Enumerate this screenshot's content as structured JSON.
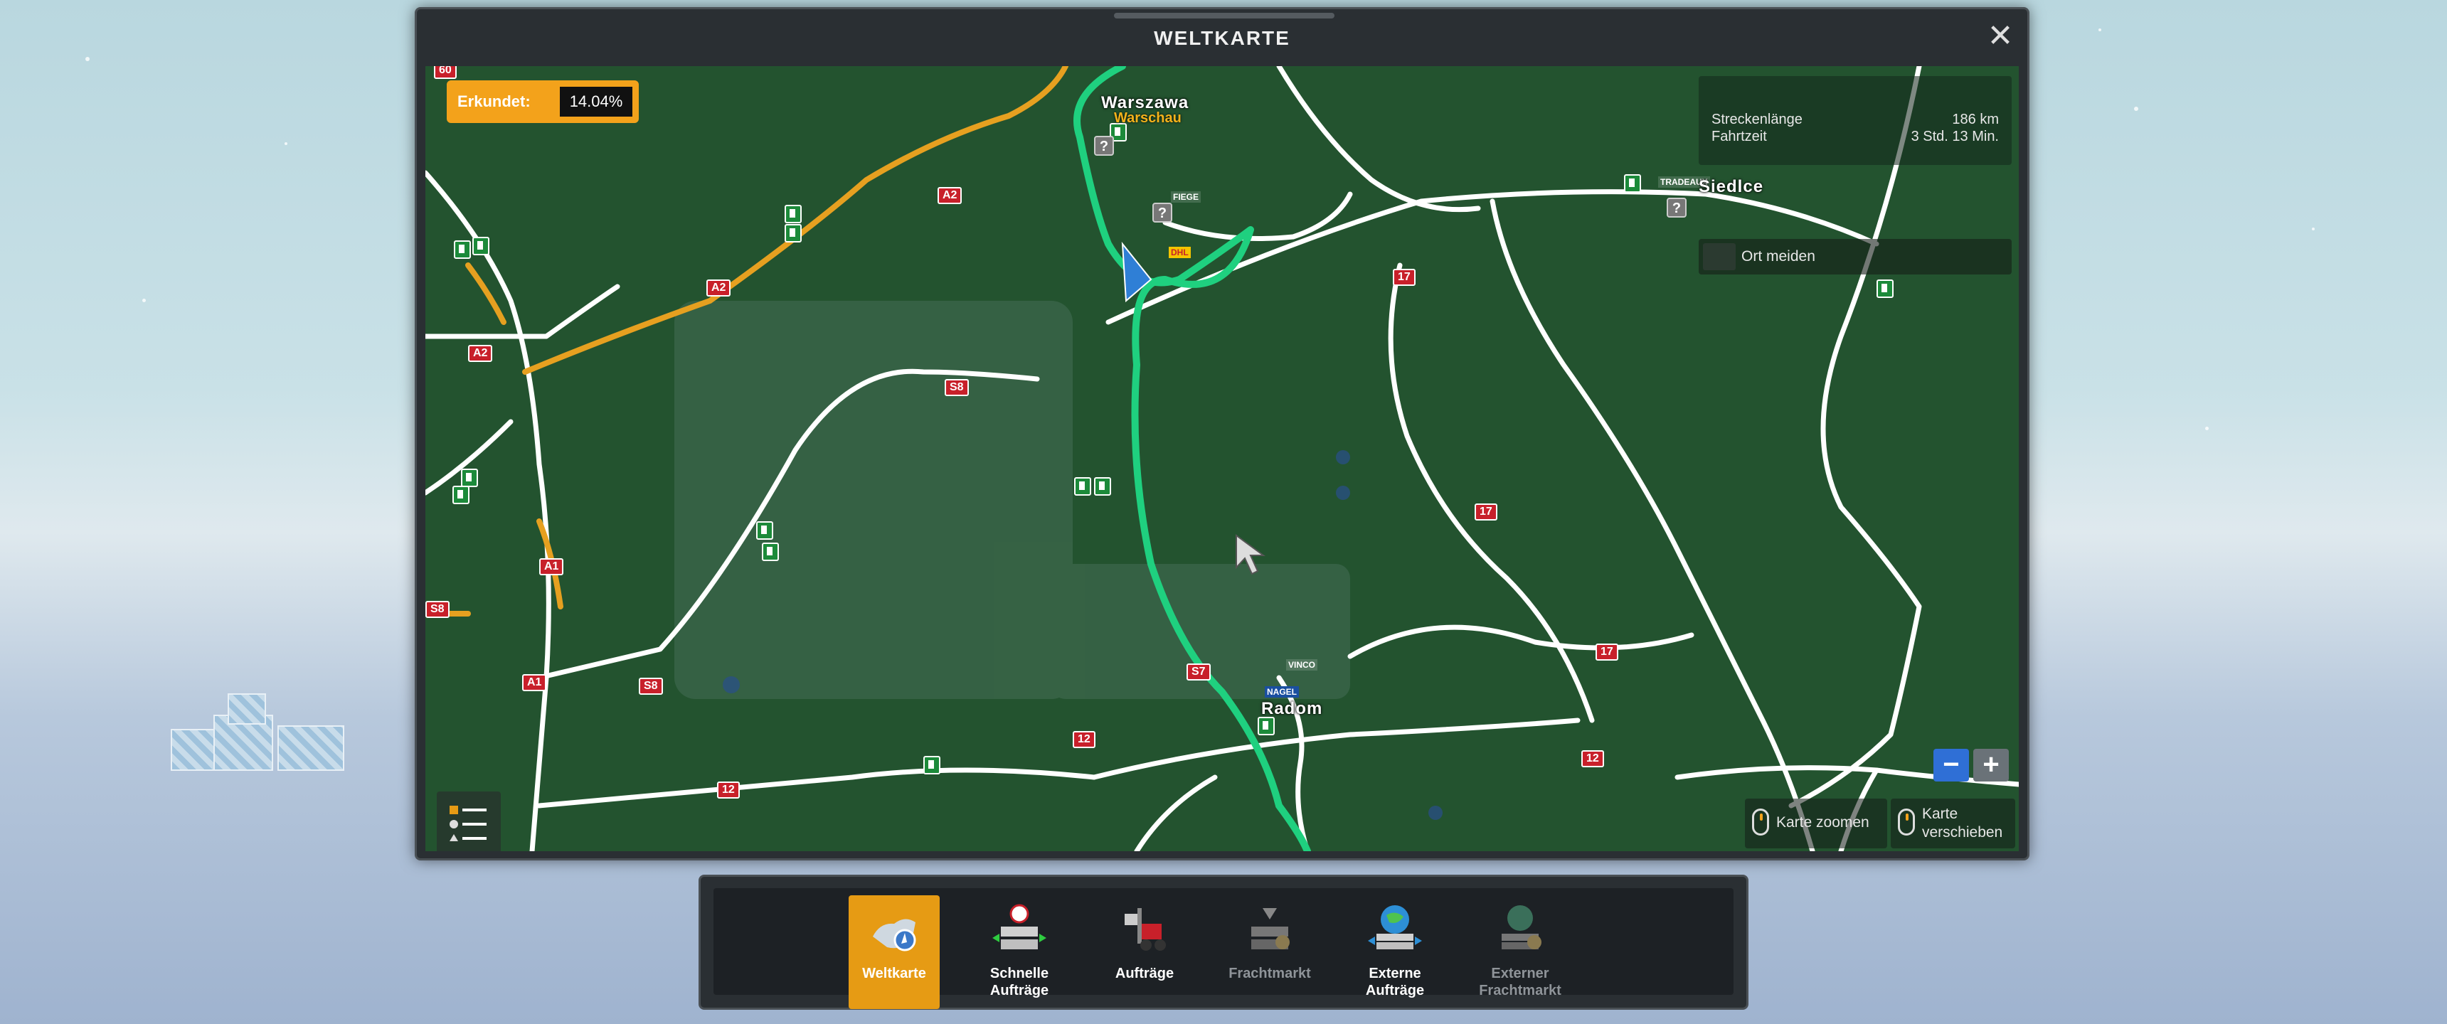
{
  "window": {
    "title": "WELTKARTE",
    "close_icon": "close-icon"
  },
  "explored": {
    "label": "Erkundet:",
    "value": "14.04%"
  },
  "route": {
    "length_label": "Streckenlänge",
    "length_value": "186 km",
    "time_label": "Fahrtzeit",
    "time_value": "3 Std. 13 Min."
  },
  "avoid": {
    "label": "Ort meiden"
  },
  "zoom": {
    "minus": "−",
    "plus": "+"
  },
  "hints": {
    "zoom": "Karte zoomen",
    "pan_line1": "Karte",
    "pan_line2": "verschieben"
  },
  "cities": [
    {
      "name": "Warszawa",
      "sub": "Warschau"
    },
    {
      "name": "Siedlce"
    },
    {
      "name": "Radom"
    }
  ],
  "roads": {
    "a2_1": "A2",
    "a2_2": "A2",
    "a2_3": "A2",
    "s8_1": "S8",
    "s8_2": "S8",
    "s8_3": "S8",
    "r17_1": "17",
    "r17_2": "17",
    "r17_3": "17",
    "s7": "S7",
    "a1_1": "A1",
    "a1_2": "A1",
    "r12_1": "12",
    "r12_2": "12",
    "r12_3": "12",
    "r60": "60"
  },
  "companies": {
    "dhl": "DHL",
    "fiege": "FIEGE",
    "nagel": "NAGEL",
    "tradeaux": "TRADEAUX",
    "vinco": "VINCO"
  },
  "toolbar": {
    "items": [
      {
        "line1": "Weltkarte",
        "line2": "",
        "state": "active"
      },
      {
        "line1": "Schnelle",
        "line2": "Aufträge",
        "state": "normal"
      },
      {
        "line1": "Aufträge",
        "line2": "",
        "state": "normal"
      },
      {
        "line1": "Frachtmarkt",
        "line2": "",
        "state": "disabled"
      },
      {
        "line1": "Externe",
        "line2": "Aufträge",
        "state": "normal"
      },
      {
        "line1": "Externer",
        "line2": "Frachtmarkt",
        "state": "disabled"
      }
    ]
  },
  "colors": {
    "accent": "#e69b14",
    "map": "#23532f",
    "route": "#1fd07f",
    "motorway": "#e6a020",
    "marker": "#2f7fd6"
  }
}
